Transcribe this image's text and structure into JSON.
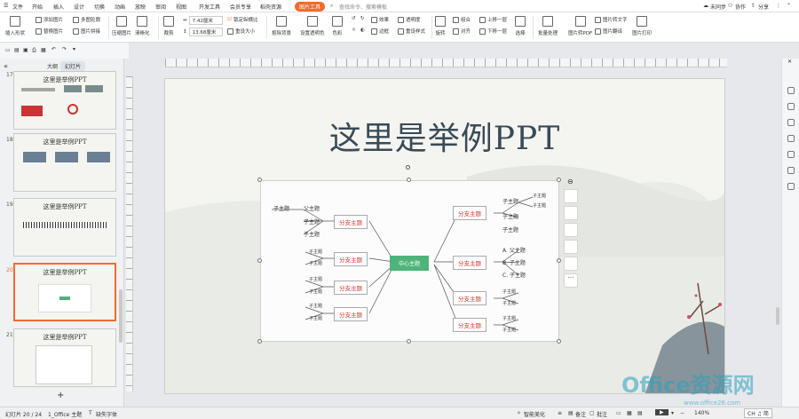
{
  "menubar": {
    "items": [
      "文件",
      "开始",
      "插入",
      "设计",
      "切换",
      "动画",
      "放映",
      "审阅",
      "视图",
      "开发工具",
      "会员专享",
      "稻壳资源"
    ],
    "active_tab": "图片工具",
    "search_placeholder": "查找命令、搜索模板",
    "right": [
      "未同步",
      "协作",
      "分享"
    ]
  },
  "ribbon": {
    "insert_shape": "插入形状",
    "add_image": "添加图片",
    "multi_contour": "多图轮廓",
    "replace_image": "替换图片",
    "image_stitch": "图片拼接",
    "compress": "压缩图片",
    "clarify": "清晰化",
    "crop": "裁剪",
    "width_value": "7.42厘米",
    "height_value": "13.68厘米",
    "lock_ratio": "锁定纵横比",
    "reset_size": "重设大小",
    "remove_bg": "抠除背景",
    "set_transparent": "设置透明色",
    "color": "色彩",
    "effect": "效果",
    "transparency": "透明度",
    "border": "边框",
    "reset_style": "重设样式",
    "rotate": "旋转",
    "group": "组合",
    "align": "对齐",
    "up_layer": "上移一层",
    "down_layer": "下移一层",
    "select": "选择",
    "batch": "批量处理",
    "to_pdf": "图片转PDF",
    "to_text": "图片转文字",
    "translate": "图片翻译",
    "print": "图片打印"
  },
  "panel": {
    "tab_outline": "大纲",
    "tab_slides": "幻灯片",
    "thumbs": [
      {
        "num": "17",
        "title": "这里是举例PPT"
      },
      {
        "num": "18",
        "title": "这里是举例PPT"
      },
      {
        "num": "19",
        "title": "这里是举例PPT"
      },
      {
        "num": "20",
        "title": "这里是举例PPT"
      },
      {
        "num": "21",
        "title": "这里是举例PPT"
      }
    ],
    "add_slide": "+"
  },
  "slide": {
    "title": "这里是举例PPT"
  },
  "mindmap": {
    "center": "中心主题",
    "branch": "分支主题",
    "sub": "子主题",
    "parent": "父主题",
    "a_parent": "A. 父主题",
    "b_sub": "B. 子主题",
    "c_sub": "C. 子主题"
  },
  "status": {
    "slide_info": "幻灯片 20 / 24",
    "theme": "1_Office 主题",
    "missing_font": "缺失字体",
    "smart_beautify": "智能美化",
    "notes": "备注",
    "comments": "批注",
    "zoom": "140%",
    "ime": "CH ♫ 简"
  },
  "watermark": {
    "text": "Office资源网",
    "url": "www.office26.com"
  }
}
